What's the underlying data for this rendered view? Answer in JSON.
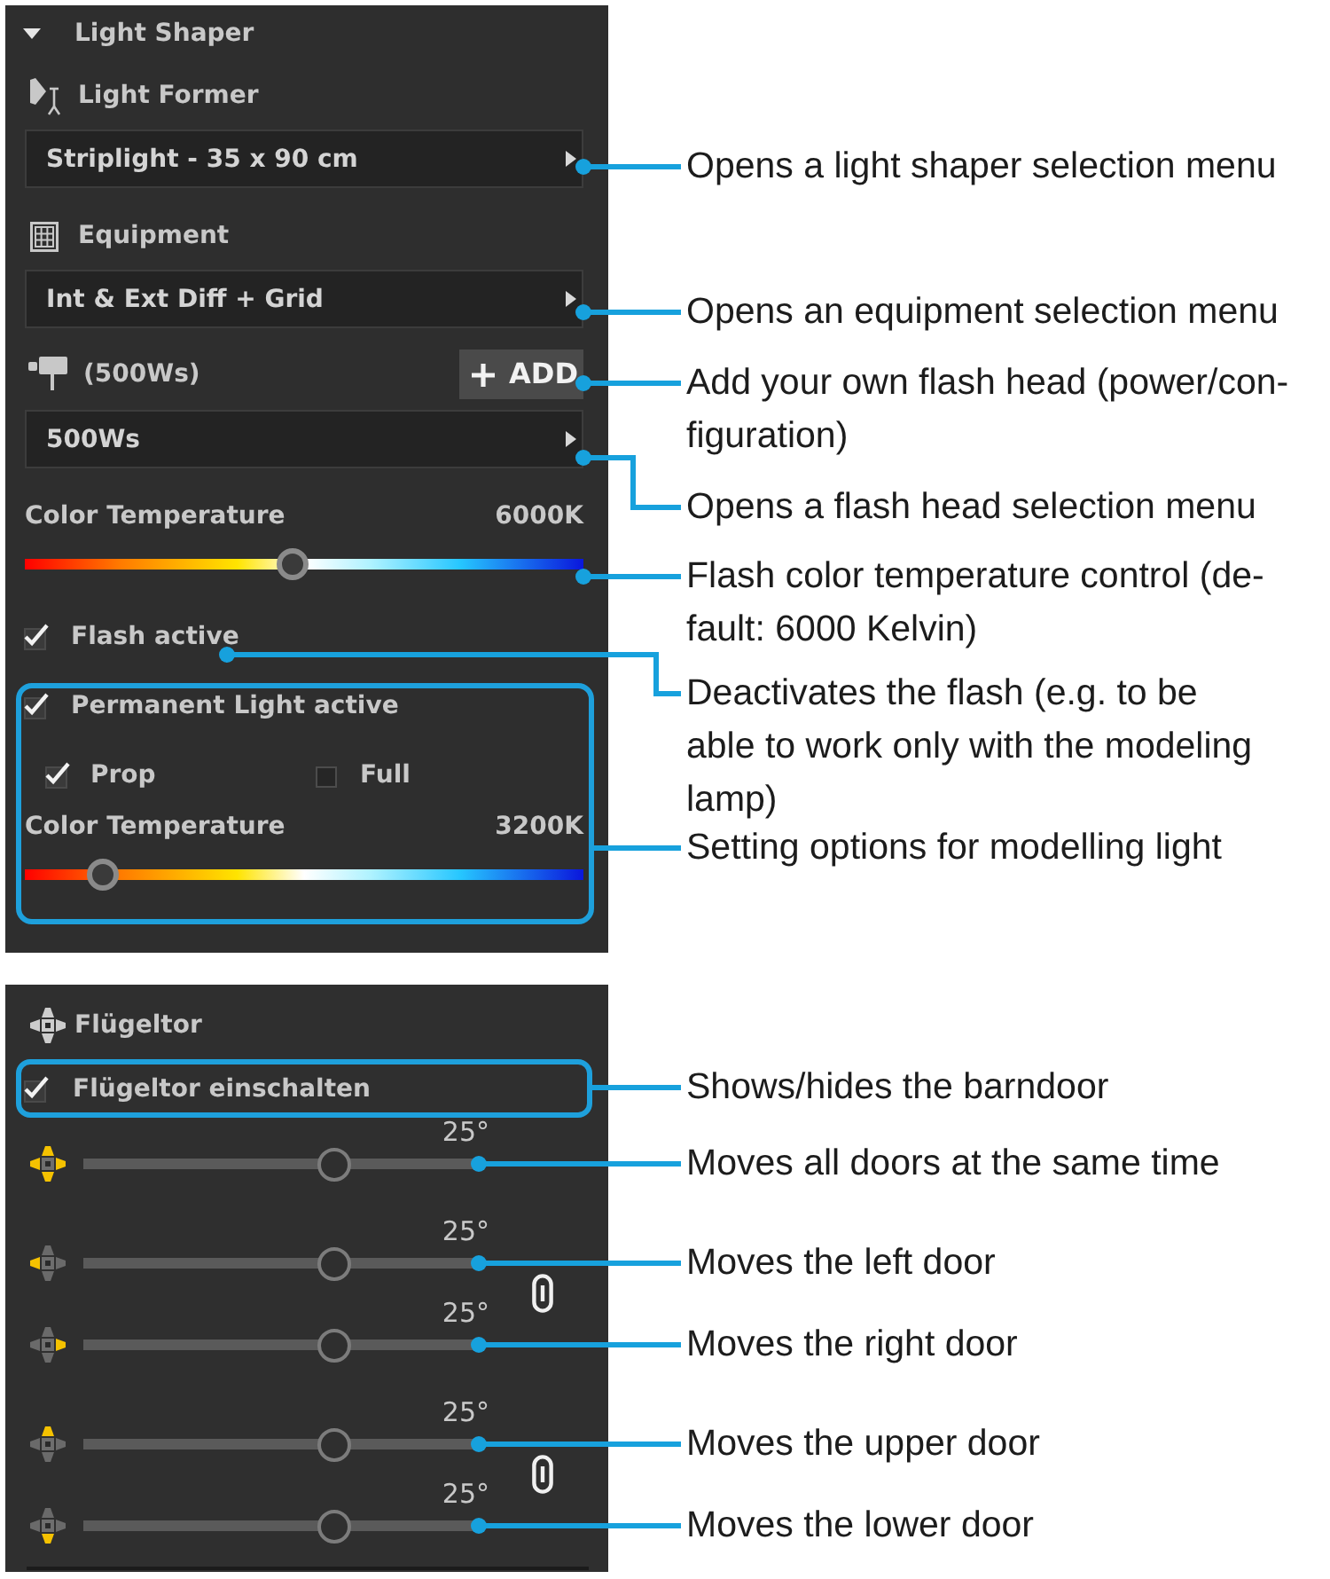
{
  "light_shaper_panel": {
    "header": {
      "label": "Light Shaper",
      "expanded": true
    },
    "light_former": {
      "label": "Light Former",
      "selection": "Striplight - 35 x 90 cm"
    },
    "equipment": {
      "label": "Equipment",
      "selection": "Int & Ext Diff + Grid"
    },
    "flash_head": {
      "label": "(500Ws)",
      "add_button": "ADD",
      "selection": "500Ws"
    },
    "flash_color_temperature": {
      "label": "Color Temperature",
      "reading": "6000K",
      "level": 0.48
    },
    "flash_active": {
      "label": "Flash active",
      "checked": true
    },
    "permanent_light": {
      "label": "Permanent Light active",
      "checked": true,
      "modes": [
        {
          "label": "Prop",
          "checked": true
        },
        {
          "label": "Full",
          "checked": false
        }
      ],
      "color_temperature": {
        "label": "Color Temperature",
        "reading": "3200K",
        "level": 0.14
      }
    }
  },
  "barndoor_panel": {
    "title": "Flügeltor",
    "enable": {
      "label": "Flügeltor einschalten",
      "checked": true
    },
    "slider_groups": [
      {
        "linked": false,
        "sliders": [
          {
            "kind": "all",
            "reading": "25°",
            "level": 0.63
          }
        ]
      },
      {
        "linked": true,
        "sliders": [
          {
            "kind": "left",
            "reading": "25°",
            "level": 0.63
          },
          {
            "kind": "right",
            "reading": "25°",
            "level": 0.63
          }
        ]
      },
      {
        "linked": true,
        "sliders": [
          {
            "kind": "upper",
            "reading": "25°",
            "level": 0.63
          },
          {
            "kind": "lower",
            "reading": "25°",
            "level": 0.63
          }
        ]
      }
    ]
  },
  "annotations": [
    {
      "lines": [
        "Opens a light shaper selection menu"
      ]
    },
    {
      "lines": [
        "Opens an equipment selection menu"
      ]
    },
    {
      "lines": [
        "Add your own flash head (power/con-",
        "figuration)"
      ]
    },
    {
      "lines": [
        "Opens a flash head selection menu"
      ]
    },
    {
      "lines": [
        "Flash color temperature control (de-",
        "fault: 6000 Kelvin)"
      ]
    },
    {
      "lines": [
        "Deactivates the flash (e.g. to be",
        "able to work only with the modeling",
        "lamp)"
      ]
    },
    {
      "lines": [
        "Setting options for modelling light"
      ]
    },
    {
      "lines": [
        "Shows/hides the barndoor"
      ]
    },
    {
      "lines": [
        "Moves all doors at the same time"
      ]
    },
    {
      "lines": [
        "Moves the left door"
      ]
    },
    {
      "lines": [
        "Moves the right door"
      ]
    },
    {
      "lines": [
        "Moves the upper door"
      ]
    },
    {
      "lines": [
        "Moves the lower door"
      ]
    }
  ]
}
